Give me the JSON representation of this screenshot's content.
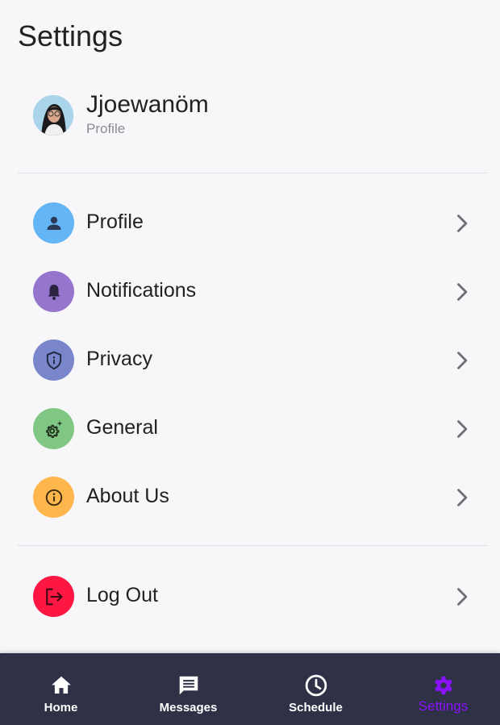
{
  "page": {
    "title": "Settings"
  },
  "user": {
    "name": "Jjoewanöm",
    "subtitle": "Profile"
  },
  "menu": [
    {
      "label": "Profile",
      "icon": "person-icon",
      "color": "#64b5f6"
    },
    {
      "label": "Notifications",
      "icon": "bell-icon",
      "color": "#9575cd"
    },
    {
      "label": "Privacy",
      "icon": "shield-icon",
      "color": "#7986cb"
    },
    {
      "label": "General",
      "icon": "gear-sparkle-icon",
      "color": "#81c784"
    },
    {
      "label": "About Us",
      "icon": "info-icon",
      "color": "#ffb74d"
    }
  ],
  "logout": {
    "label": "Log Out",
    "icon": "logout-icon",
    "color": "#ff1744"
  },
  "nav": {
    "items": [
      {
        "label": "Home",
        "icon": "home-icon"
      },
      {
        "label": "Messages",
        "icon": "message-icon"
      },
      {
        "label": "Schedule",
        "icon": "clock-icon"
      },
      {
        "label": "Settings",
        "icon": "gear-icon",
        "active": true
      }
    ],
    "active_color": "#8a12ff",
    "background": "#2f3146"
  }
}
